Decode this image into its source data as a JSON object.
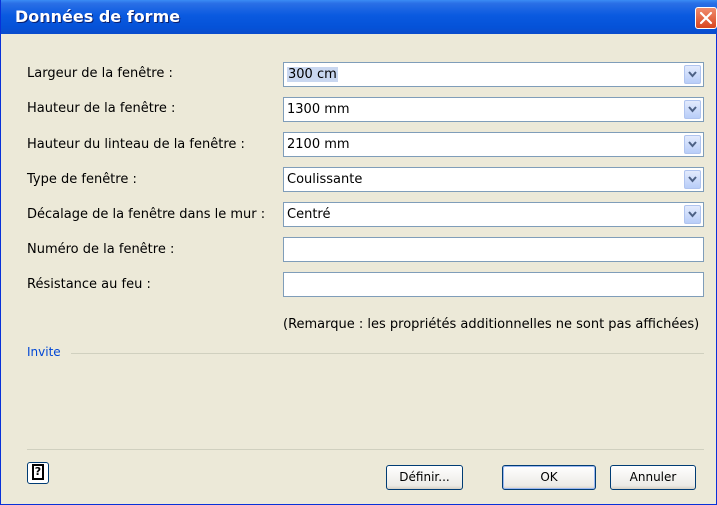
{
  "window": {
    "title": "Données de forme"
  },
  "fields": [
    {
      "label": "Largeur de la fenêtre :",
      "value": "300 cm",
      "selected": true,
      "has_dropdown": true
    },
    {
      "label": "Hauteur de la fenêtre :",
      "value": "1300 mm",
      "selected": false,
      "has_dropdown": true
    },
    {
      "label": "Hauteur du linteau de la fenêtre :",
      "value": "2100 mm",
      "selected": false,
      "has_dropdown": true
    },
    {
      "label": "Type de fenêtre :",
      "value": "Coulissante",
      "selected": false,
      "has_dropdown": true
    },
    {
      "label": "Décalage de la fenêtre dans le mur :",
      "value": "Centré",
      "selected": false,
      "has_dropdown": true
    },
    {
      "label": "Numéro de la fenêtre :",
      "value": "",
      "selected": false,
      "has_dropdown": false
    },
    {
      "label": "Résistance au feu :",
      "value": "",
      "selected": false,
      "has_dropdown": false
    }
  ],
  "remark": "(Remarque : les propriétés additionnelles ne sont pas affichées)",
  "prompt": {
    "label": "Invite"
  },
  "buttons": {
    "help_icon": "help-icon",
    "define": "Définir...",
    "ok": "OK",
    "cancel": "Annuler"
  },
  "colors": {
    "title_bar": "#0a5ae0",
    "dialog_bg": "#ece9d8",
    "close_button": "#d8451f",
    "prompt_label": "#0046d5"
  }
}
